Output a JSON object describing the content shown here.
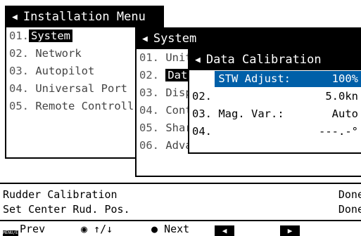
{
  "installation_menu": {
    "title": "Installation Menu",
    "items": [
      {
        "num": "01.",
        "label": "System"
      },
      {
        "num": "02.",
        "label": "Network"
      },
      {
        "num": "03.",
        "label": "Autopilot"
      },
      {
        "num": "04.",
        "label": "Universal Port"
      },
      {
        "num": "05.",
        "label": "Remote Controll"
      }
    ]
  },
  "system_menu": {
    "title": "System",
    "items": [
      {
        "num": "01.",
        "label": "Unit"
      },
      {
        "num": "02.",
        "label": "Data"
      },
      {
        "num": "03.",
        "label": "Disp"
      },
      {
        "num": "04.",
        "label": "Cont"
      },
      {
        "num": "05.",
        "label": "Shar"
      },
      {
        "num": "06.",
        "label": "Advanced"
      }
    ]
  },
  "data_calibration": {
    "title": "Data Calibration",
    "items": [
      {
        "num": "01.",
        "label": "STW Adjust:",
        "value": "100%"
      },
      {
        "num": "02.",
        "label": "",
        "value": "5.0kn"
      },
      {
        "num": "03.",
        "label": "Mag. Var.:",
        "value": "Auto"
      },
      {
        "num": "04.",
        "label": "",
        "value": "---.-°"
      }
    ]
  },
  "status": {
    "line1": {
      "label": "Rudder Calibration",
      "value": "Done"
    },
    "line2": {
      "label": "Set Center Rud. Pos.",
      "value": "Done"
    }
  },
  "softkeys": {
    "menu_icon_text": "MENU/ESC",
    "prev": "Prev",
    "updown": "↑/↓",
    "next": "Next"
  },
  "colors": {
    "highlight": "#005fa8"
  }
}
